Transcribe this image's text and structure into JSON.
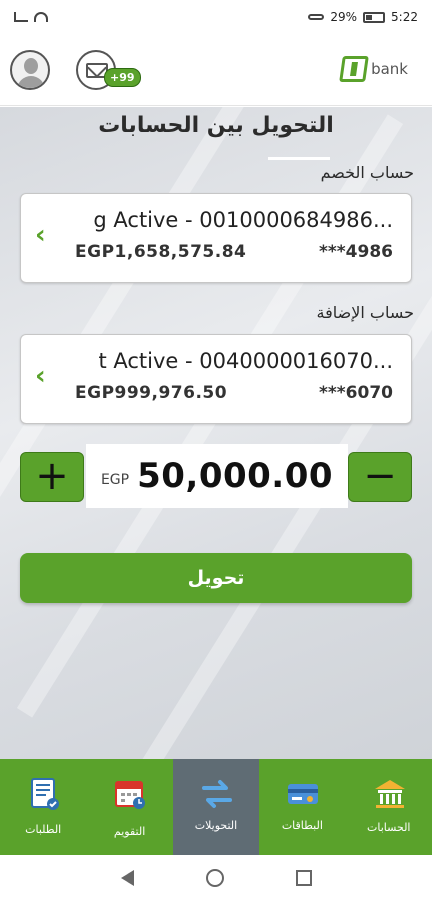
{
  "status_bar": {
    "battery": "29%",
    "time": "5:22"
  },
  "header": {
    "mail_badge": "+99",
    "logo_text": "bank"
  },
  "page": {
    "title": "التحويل بين الحسابات"
  },
  "from_account": {
    "label": "حساب الخصم",
    "name": "g Active - 0010000684986...",
    "balance": "EGP1,658,575.84",
    "masked_number": "***4986"
  },
  "to_account": {
    "label": "حساب الإضافة",
    "name": "t Active - 0040000016070...",
    "balance": "EGP999,976.50",
    "masked_number": "***6070"
  },
  "amount": {
    "currency": "EGP",
    "value": "50,000.00",
    "increment": "+",
    "decrement": "−"
  },
  "transfer_button": {
    "label": "تحويل"
  },
  "bottom_nav": {
    "items": [
      {
        "label": "الطلبات",
        "icon": "requests-icon",
        "active": false
      },
      {
        "label": "التقويم",
        "icon": "calendar-icon",
        "active": false
      },
      {
        "label": "التحويلات",
        "icon": "transfers-icon",
        "active": true
      },
      {
        "label": "البطاقات",
        "icon": "cards-icon",
        "active": false
      },
      {
        "label": "الحسابات",
        "icon": "accounts-icon",
        "active": false
      }
    ]
  },
  "colors": {
    "accent": "#5aa22b",
    "active_nav": "#5f6c74"
  }
}
